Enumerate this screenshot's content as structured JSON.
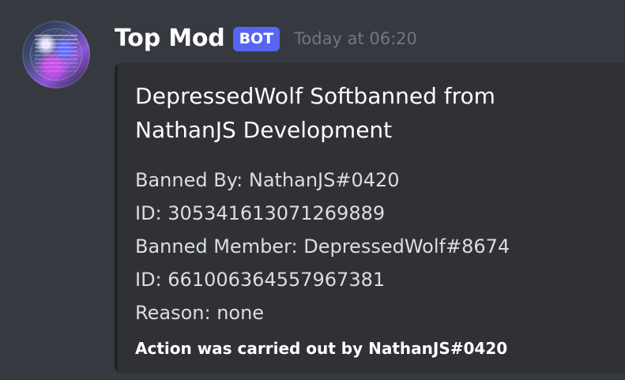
{
  "message": {
    "author": "Top Mod",
    "badge": "BOT",
    "timestamp": "Today at 06:20",
    "avatar_icon": "avatar-icon"
  },
  "embed": {
    "title_name": "DepressedWolf",
    "title_rest": "Softbanned from NathanJS Development",
    "lines": [
      {
        "label": "Banned By: ",
        "value": "NathanJS#0420"
      },
      {
        "label": "ID: ",
        "value": "305341613071269889"
      },
      {
        "label": "Banned Member: ",
        "value": "DepressedWolf#8674"
      },
      {
        "label": "ID: ",
        "value": "661006364557967381"
      },
      {
        "label": "Reason: ",
        "value": "none"
      }
    ],
    "footer": "Action was carried out by NathanJS#0420"
  },
  "colors": {
    "background": "#36393f",
    "embed_background": "#2f3136",
    "embed_bar": "#202225",
    "bot_badge": "#5865f2",
    "timestamp": "#72767d",
    "text": "#dcddde",
    "title": "#ffffff"
  }
}
